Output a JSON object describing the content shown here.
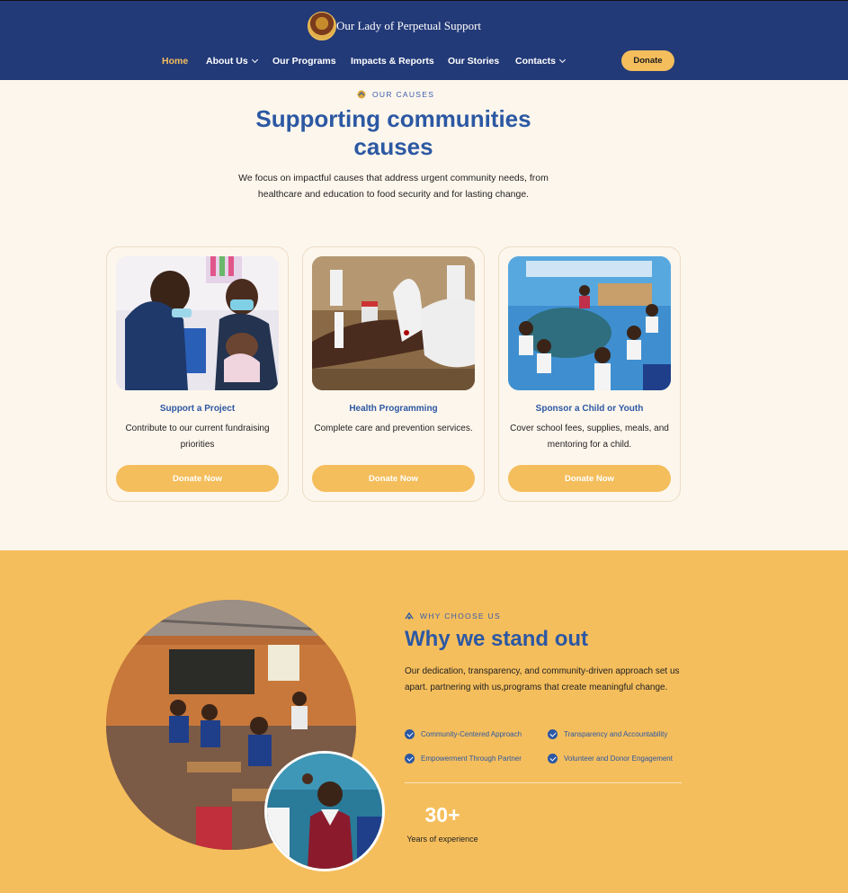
{
  "header": {
    "brand": "Our Lady of Perpetual Support",
    "nav": [
      {
        "label": "Home",
        "active": true
      },
      {
        "label": "About Us",
        "dropdown": true
      },
      {
        "label": "Our Programs"
      },
      {
        "label": "Impacts & Reports"
      },
      {
        "label": "Our Stories"
      },
      {
        "label": "Contacts",
        "dropdown": true
      }
    ],
    "donate": "Donate"
  },
  "causes": {
    "eyebrow": "OUR CAUSES",
    "title": "Supporting communities causes",
    "description": "We focus on impactful causes that address urgent community needs, from healthcare and education to food security and for lasting change.",
    "cards": [
      {
        "title": "Support a Project",
        "description": "Contribute to our current fundraising priorities",
        "button": "Donate Now"
      },
      {
        "title": "Health Programming",
        "description": "Complete care and prevention services.",
        "button": "Donate Now"
      },
      {
        "title": "Sponsor a Child or Youth",
        "description": "Cover school fees, supplies, meals, and mentoring for a child.",
        "button": "Donate Now"
      }
    ]
  },
  "why": {
    "eyebrow": "WHY CHOOSE US",
    "title": "Why we stand out",
    "description": "Our dedication, transparency, and community-driven approach set us apart. partnering with us,programs that create meaningful change.",
    "features": [
      "Community-Centered Approach",
      "Transparency and Accountability",
      "Empowerment Through Partner",
      "Volunteer and Donor Engagement"
    ],
    "stat_value": "30+",
    "stat_label": "Years of experience"
  },
  "colors": {
    "navy": "#233a78",
    "accent_yellow": "#f4be5c",
    "heading_blue": "#2c58a3",
    "cream": "#fdf6ec"
  }
}
